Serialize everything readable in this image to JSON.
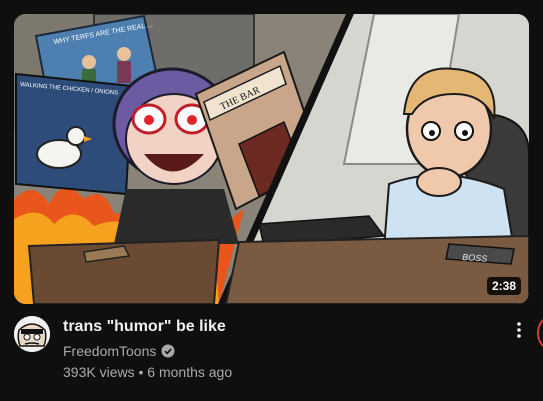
{
  "video": {
    "title": "trans \"humor\" be like",
    "channel": "FreedomToons",
    "views": "393K views",
    "separator": "•",
    "age": "6 months ago",
    "duration": "2:38"
  },
  "thumbnail": {
    "sign_text": "THE BAR",
    "nameplate_text": "BOSS",
    "poster_text": "WHY TERFS ARE THE REAL ...",
    "panel_text": "WALKING THE CHICKEN / ONIONS"
  },
  "icons": {
    "verified": "verified-check-icon",
    "more": "more-vert-icon"
  },
  "colors": {
    "background": "#0f0f0f",
    "title": "#f1f1f1",
    "secondary": "#aaaaaa"
  }
}
